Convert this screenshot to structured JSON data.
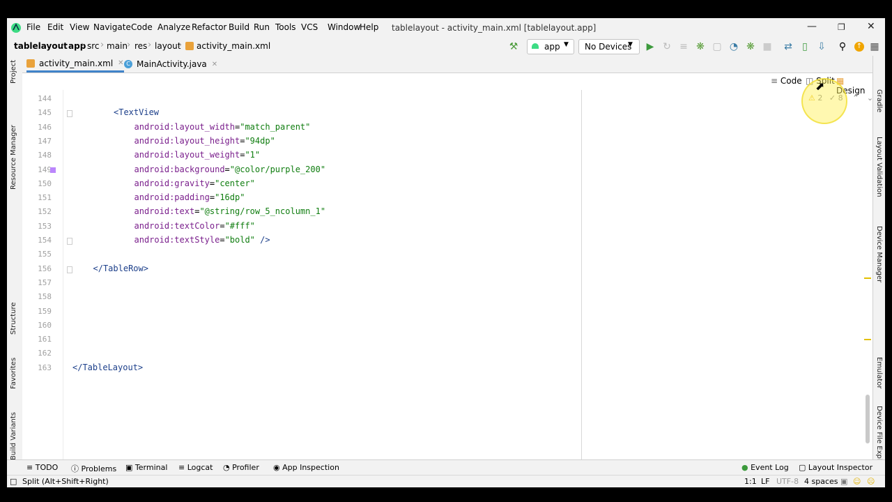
{
  "menu": [
    "File",
    "Edit",
    "View",
    "Navigate",
    "Code",
    "Analyze",
    "Refactor",
    "Build",
    "Run",
    "Tools",
    "VCS",
    "Window",
    "Help"
  ],
  "window_title": "tablelayout - activity_main.xml [tablelayout.app]",
  "breadcrumb": [
    "tablelayout",
    "app",
    "src",
    "main",
    "res",
    "layout",
    "activity_main.xml"
  ],
  "run_config": "app",
  "device": "No Devices",
  "tabs": [
    {
      "label": "activity_main.xml",
      "active": true
    },
    {
      "label": "MainActivity.java",
      "active": false
    }
  ],
  "view_modes": {
    "code": "Code",
    "split": "Split",
    "design": "Design"
  },
  "inspections": {
    "warnings": "2",
    "weak_warnings": "8"
  },
  "lines": [
    {
      "n": "144",
      "indent": 0,
      "parts": []
    },
    {
      "n": "145",
      "indent": 2,
      "parts": [
        {
          "t": "<TextView",
          "c": "tag"
        }
      ]
    },
    {
      "n": "146",
      "indent": 3,
      "parts": [
        {
          "t": "android:layout_width",
          "c": "attr"
        },
        {
          "t": "=",
          "c": "plain"
        },
        {
          "t": "\"match_parent\"",
          "c": "val"
        }
      ]
    },
    {
      "n": "147",
      "indent": 3,
      "parts": [
        {
          "t": "android:layout_height",
          "c": "attr"
        },
        {
          "t": "=",
          "c": "plain"
        },
        {
          "t": "\"94dp\"",
          "c": "val"
        }
      ]
    },
    {
      "n": "148",
      "indent": 3,
      "parts": [
        {
          "t": "android:layout_weight",
          "c": "attr"
        },
        {
          "t": "=",
          "c": "plain"
        },
        {
          "t": "\"1\"",
          "c": "val"
        }
      ]
    },
    {
      "n": "149",
      "indent": 3,
      "parts": [
        {
          "t": "android:background",
          "c": "attr"
        },
        {
          "t": "=",
          "c": "plain"
        },
        {
          "t": "\"@color/purple_200\"",
          "c": "val"
        }
      ]
    },
    {
      "n": "150",
      "indent": 3,
      "parts": [
        {
          "t": "android:gravity",
          "c": "attr"
        },
        {
          "t": "=",
          "c": "plain"
        },
        {
          "t": "\"center\"",
          "c": "val"
        }
      ]
    },
    {
      "n": "151",
      "indent": 3,
      "parts": [
        {
          "t": "android:padding",
          "c": "attr"
        },
        {
          "t": "=",
          "c": "plain"
        },
        {
          "t": "\"16dp\"",
          "c": "val"
        }
      ]
    },
    {
      "n": "152",
      "indent": 3,
      "parts": [
        {
          "t": "android:text",
          "c": "attr"
        },
        {
          "t": "=",
          "c": "plain"
        },
        {
          "t": "\"@string/row_5_ncolumn_1\"",
          "c": "val"
        }
      ]
    },
    {
      "n": "153",
      "indent": 3,
      "parts": [
        {
          "t": "android:textColor",
          "c": "attr"
        },
        {
          "t": "=",
          "c": "plain"
        },
        {
          "t": "\"#fff\"",
          "c": "val"
        }
      ]
    },
    {
      "n": "154",
      "indent": 3,
      "parts": [
        {
          "t": "android:textStyle",
          "c": "attr"
        },
        {
          "t": "=",
          "c": "plain"
        },
        {
          "t": "\"bold\"",
          "c": "val"
        },
        {
          "t": " />",
          "c": "tag"
        }
      ]
    },
    {
      "n": "155",
      "indent": 0,
      "parts": []
    },
    {
      "n": "156",
      "indent": 1,
      "parts": [
        {
          "t": "</TableRow>",
          "c": "tag"
        }
      ]
    },
    {
      "n": "157",
      "indent": 0,
      "parts": []
    },
    {
      "n": "158",
      "indent": 0,
      "parts": []
    },
    {
      "n": "159",
      "indent": 0,
      "parts": []
    },
    {
      "n": "160",
      "indent": 0,
      "parts": []
    },
    {
      "n": "161",
      "indent": 0,
      "parts": []
    },
    {
      "n": "162",
      "indent": 0,
      "parts": []
    },
    {
      "n": "163",
      "indent": 0,
      "parts": [
        {
          "t": "</TableLayout>",
          "c": "tag"
        }
      ]
    }
  ],
  "left_strip": [
    "Project",
    "Resource Manager",
    "Structure",
    "Favorites",
    "Build Variants"
  ],
  "right_strip": [
    "Gradle",
    "Layout Validation",
    "Device Manager",
    "Emulator",
    "Device File Explorer"
  ],
  "bottom_tools": [
    "TODO",
    "Problems",
    "Terminal",
    "Logcat",
    "Profiler",
    "App Inspection"
  ],
  "bottom_right_tools": [
    "Event Log",
    "Layout Inspector"
  ],
  "status": {
    "hint": "Split (Alt+Shift+Right)",
    "position": "1:1",
    "line_sep": "LF",
    "encoding": "UTF-8",
    "indent": "4 spaces"
  },
  "colors": {
    "accent": "#4083c9",
    "tag": "#1c3f8a",
    "attr": "#7a1f8c",
    "value": "#0f7d0f",
    "purple_200": "#bb86fc"
  }
}
